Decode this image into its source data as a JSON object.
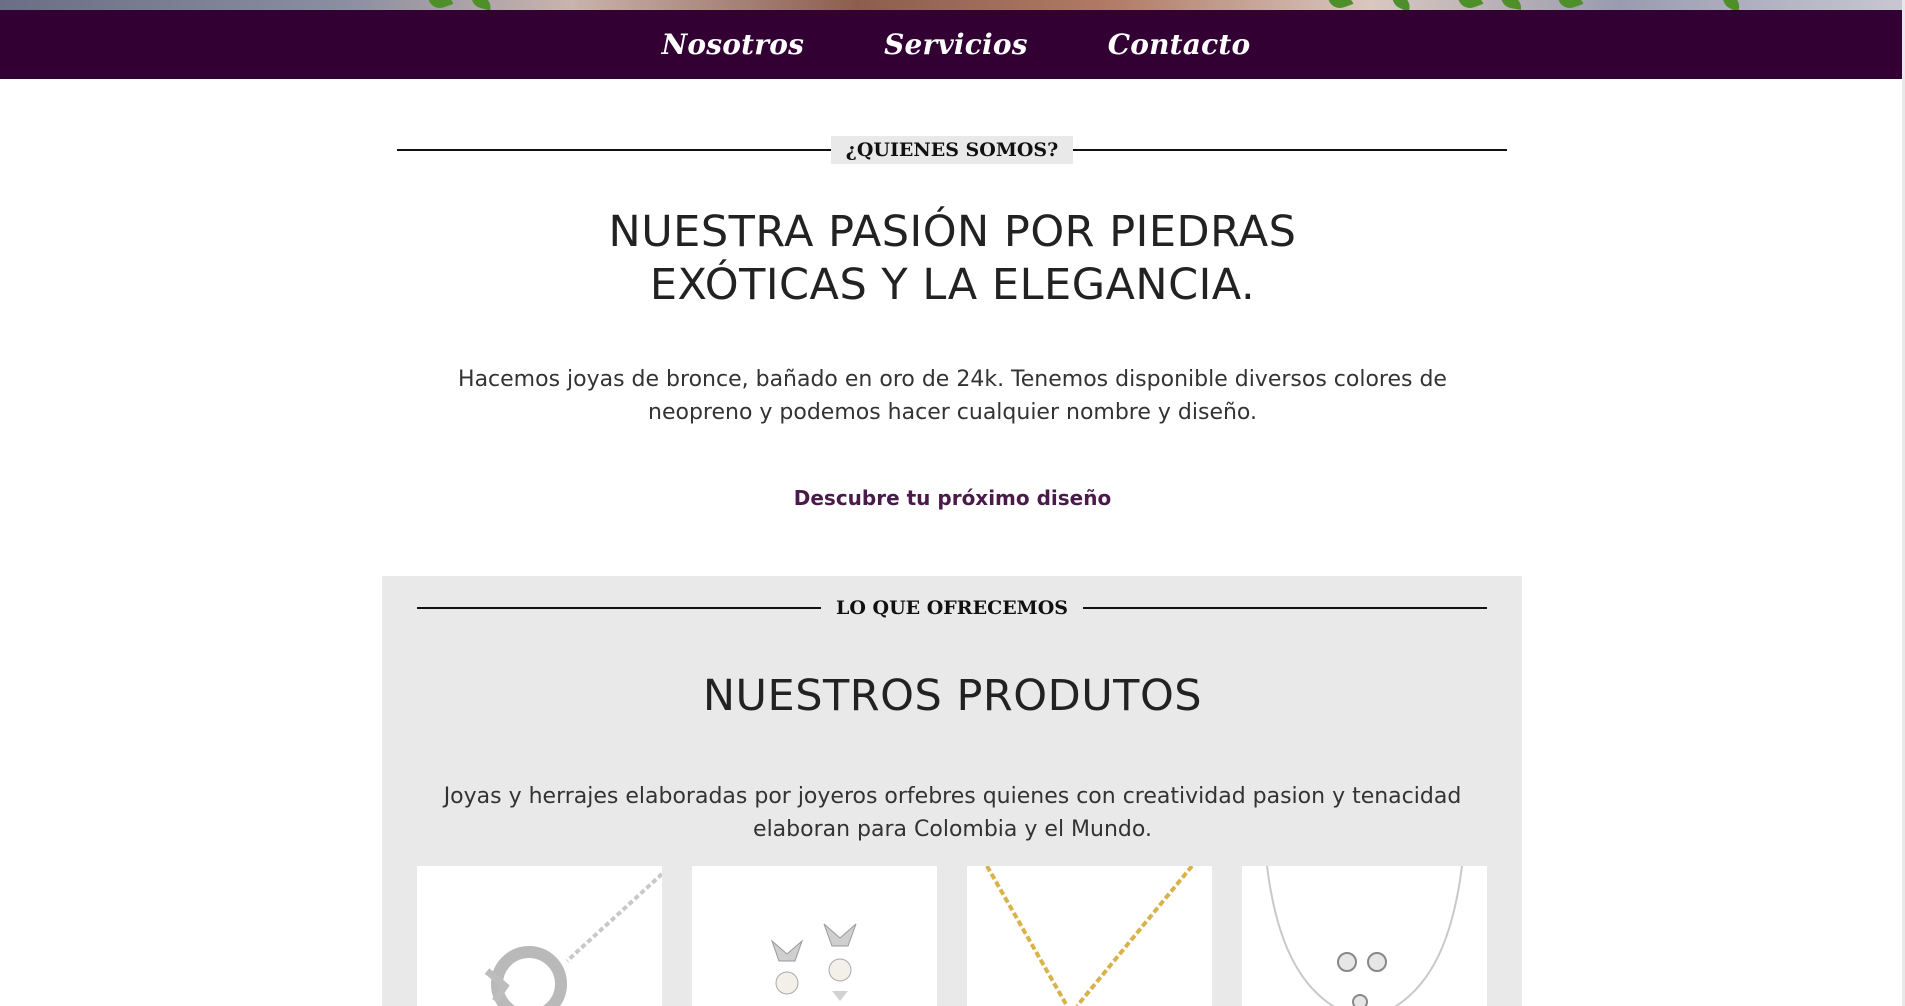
{
  "nav": {
    "items": [
      {
        "label": "Nosotros"
      },
      {
        "label": "Servicios"
      },
      {
        "label": "Contacto"
      }
    ]
  },
  "about": {
    "section_label": "¿QUIENES SOMOS?",
    "headline_line1": "NUESTRA PASIÓN POR PIEDRAS",
    "headline_line2": "EXÓTICAS Y LA ELEGANCIA.",
    "description": "Hacemos joyas de bronce, bañado en oro de 24k. Tenemos disponible diversos colores de neopreno y podemos hacer cualquier nombre y diseño.",
    "cta_label": "Descubre tu próximo diseño"
  },
  "offer": {
    "section_label": "LO QUE OFRECEMOS",
    "headline": "NUESTROS PRODUTOS",
    "description": "Joyas y herrajes elaboradas por joyeros orfebres quienes con creatividad pasion y tenacidad elaboran para Colombia y el Mundo.",
    "products": [
      {
        "name": "silver-chain-ring-pendant"
      },
      {
        "name": "butterfly-pearl-earrings"
      },
      {
        "name": "gold-chain-necklace"
      },
      {
        "name": "silver-necklace-stud-earrings"
      }
    ]
  },
  "colors": {
    "nav_background": "#330033",
    "cta_color": "#4a1a4a",
    "panel_background": "#e9e9e9"
  }
}
